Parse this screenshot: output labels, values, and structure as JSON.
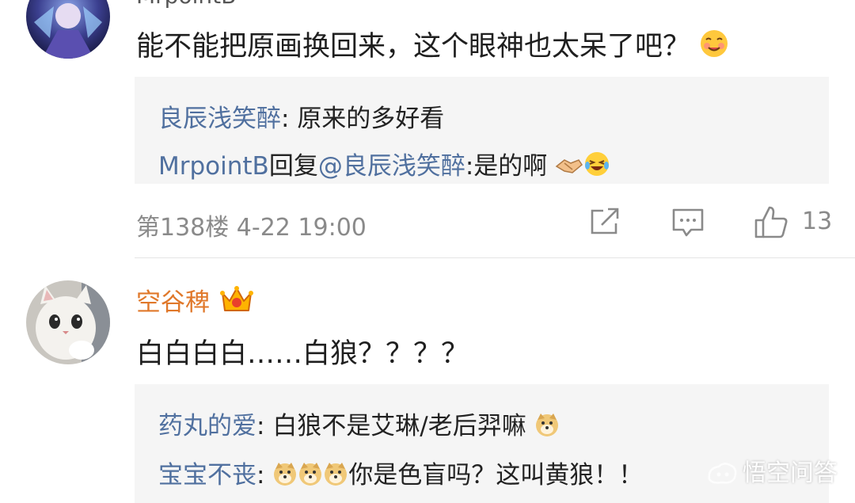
{
  "comment1": {
    "username_partial": "MrpointB",
    "text": "能不能把原画换回来，这个眼神也太呆了吧？",
    "emoji_end": "yum-face-icon",
    "replies": [
      {
        "user": "良辰浅笑醉",
        "sep": ": ",
        "text": "原来的多好看"
      },
      {
        "user": "MrpointB",
        "mid": "回复",
        "mention": "@良辰浅笑醉",
        "sep": ":",
        "text": "是的啊",
        "emojis": [
          "handshake-icon",
          "laughing-tears-icon"
        ]
      }
    ],
    "meta": "第138楼 4-22 19:00",
    "likes": "13"
  },
  "comment2": {
    "username": "空谷稗",
    "badge": "crown-icon",
    "text": "白白白白……白狼？？？？",
    "replies": [
      {
        "user": "药丸的爱",
        "sep": ": ",
        "text": "白狼不是艾琳/老后羿嘛",
        "emoji": "doge-icon"
      },
      {
        "user": "宝宝不丧",
        "sep": ": ",
        "text": "你是色盲吗？这叫黄狼！！",
        "emojis": [
          "doge-icon",
          "doge-icon",
          "doge-icon"
        ]
      }
    ]
  },
  "watermark": "悟空问答",
  "colors": {
    "link": "#50709f",
    "username_orange": "#e0782a",
    "meta_gray": "#8a8a8a",
    "reply_bg": "#f5f5f5"
  }
}
